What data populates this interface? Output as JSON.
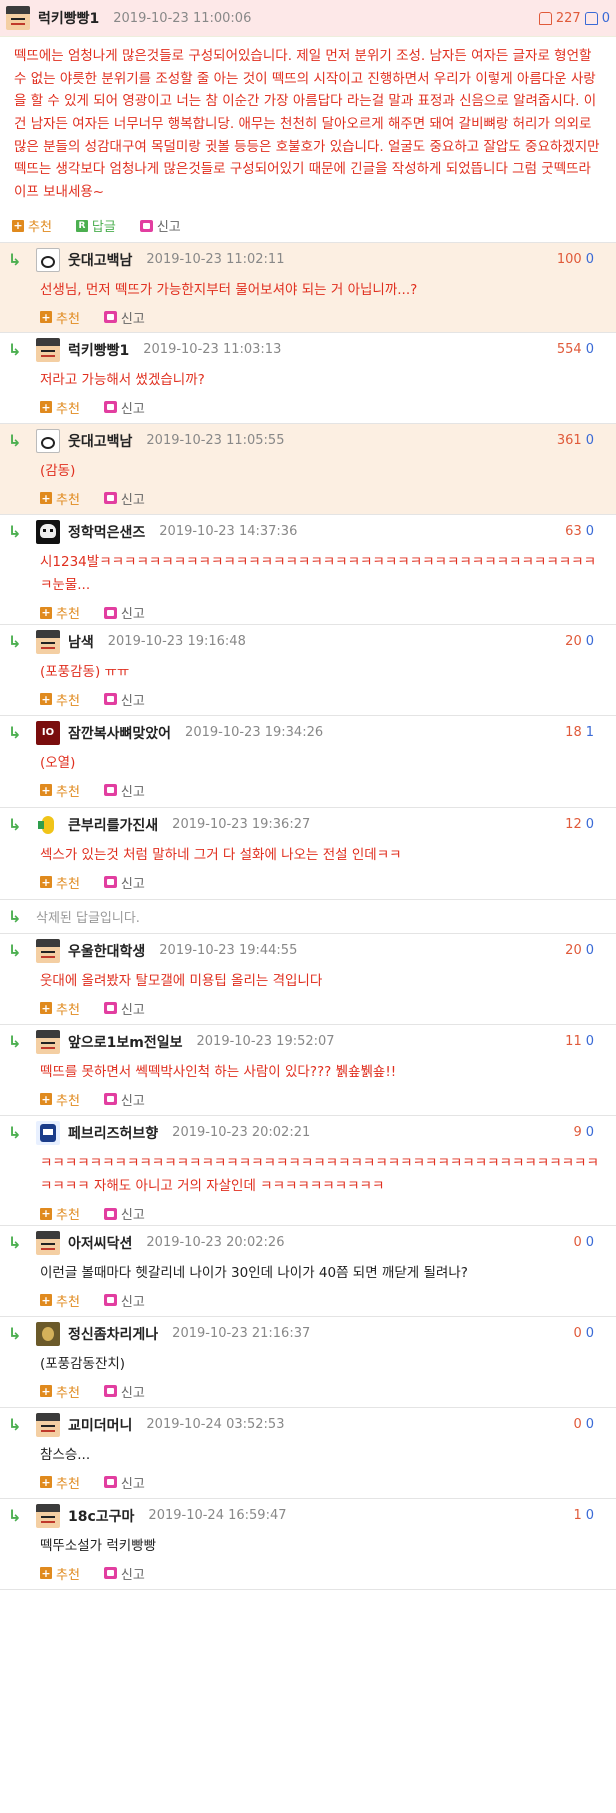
{
  "post": {
    "nickname": "럭키빵빵1",
    "date": "2019-10-23 11:00:06",
    "up_votes": "227",
    "down_votes": "0",
    "body": "떽뜨에는 엄청나게 많은것들로 구성되어있습니다. 제일 먼저 분위기 조성. 남자든 여자든 글자로 형언할 수 없는 야릇한 분위기를 조성할 줄 아는 것이 떽뜨의 시작이고 진행하면서 우리가 이렇게 아름다운 사랑을 할 수 있게 되어 영광이고 너는 참 이순간 가장 아름답다 라는걸 말과 표정과 신음으로 알려줍시다. 이건 남자든 여자든 너무너무 행복합니당. 애무는 천천히 달아오르게 해주면 돼여 갈비뼈랑 허리가 의외로 많은 분들의 성감대구여 목덜미랑 귓볼 등등은 호불호가 있습니다. 얼굴도 중요하고 잘압도 중요하겠지만 떽뜨는 생각보다 엄청나게 많은것들로 구성되어있기 때문에 긴글을 작성하게 되었뜹니다 그럼 굿떽뜨라이프 보내세용~",
    "actions": {
      "recommend": "추천",
      "reply": "답글",
      "report": "신고"
    }
  },
  "labels": {
    "recommend": "추천",
    "report": "신고"
  },
  "comments": [
    {
      "nickname": "웃대고백남",
      "date": "2019-10-23 11:02:11",
      "up": "100",
      "down": "0",
      "body": "선생님, 먼저 떽뜨가 가능한지부터 물어보셔야 되는 거 아닙니까...?"
    },
    {
      "nickname": "럭키빵빵1",
      "date": "2019-10-23 11:03:13",
      "up": "554",
      "down": "0",
      "body": "저라고 가능해서 썼겠습니까?"
    },
    {
      "nickname": "웃대고백남",
      "date": "2019-10-23 11:05:55",
      "up": "361",
      "down": "0",
      "body": "(감동)"
    },
    {
      "nickname": "정학먹은샌즈",
      "date": "2019-10-23 14:37:36",
      "up": "63",
      "down": "0",
      "body": "시1234발ㅋㅋㅋㅋㅋㅋㅋㅋㅋㅋㅋㅋㅋㅋㅋㅋㅋㅋㅋㅋㅋㅋㅋㅋㅋㅋㅋㅋㅋㅋㅋㅋㅋㅋㅋㅋㅋㅋㅋㅋㅋ눈물..."
    },
    {
      "nickname": "남색",
      "date": "2019-10-23 19:16:48",
      "up": "20",
      "down": "0",
      "body": "(포풍감동) ㅠㅠ"
    },
    {
      "nickname": "잠깐복사뼈맞았어",
      "date": "2019-10-23 19:34:26",
      "up": "18",
      "down": "1",
      "body": "(오열)"
    },
    {
      "nickname": "큰부리를가진새",
      "date": "2019-10-23 19:36:27",
      "up": "12",
      "down": "0",
      "body": "섹스가 있는것 처럼 말하네 그거 다 설화에 나오는 전설 인데ㅋㅋ"
    },
    {
      "deleted_text": "삭제된 답글입니다."
    },
    {
      "nickname": "우울한대학생",
      "date": "2019-10-23 19:44:55",
      "up": "20",
      "down": "0",
      "body": "웃대에 올려봤자 탈모갤에 미용팁 올리는 격입니다"
    },
    {
      "nickname": "앞으로1보m전일보",
      "date": "2019-10-23 19:52:07",
      "up": "11",
      "down": "0",
      "body": "떽뜨를 못하면서 쎅떽박사인척 하는 사람이 있다??? 뷁숖뷁숖!!"
    },
    {
      "nickname": "페브리즈허브향",
      "date": "2019-10-23 20:02:21",
      "up": "9",
      "down": "0",
      "body": "ㅋㅋㅋㅋㅋㅋㅋㅋㅋㅋㅋㅋㅋㅋㅋㅋㅋㅋㅋㅋㅋㅋㅋㅋㅋㅋㅋㅋㅋㅋㅋㅋㅋㅋㅋㅋㅋㅋㅋㅋㅋㅋㅋㅋㅋㅋㅋㅋㅋ 자해도 아니고 거의 자살인데 ㅋㅋㅋㅋㅋㅋㅋㅋㅋㅋ"
    },
    {
      "nickname": "아저씨닥션",
      "date": "2019-10-23 20:02:26",
      "up": "0",
      "down": "0",
      "body": "이런글 볼때마다 헷갈리네 나이가 30인데 나이가 40쯤 되면 깨닫게 될려나?"
    },
    {
      "nickname": "정신좀차리게나",
      "date": "2019-10-23 21:16:37",
      "up": "0",
      "down": "0",
      "body": "(포풍감동잔치)"
    },
    {
      "nickname": "교미더머니",
      "date": "2019-10-24 03:52:53",
      "up": "0",
      "down": "0",
      "body": "참스승..."
    },
    {
      "nickname": "18c고구마",
      "date": "2019-10-24 16:59:47",
      "up": "1",
      "down": "0",
      "body": "떽뚜소설가 럭키빵빵"
    }
  ]
}
